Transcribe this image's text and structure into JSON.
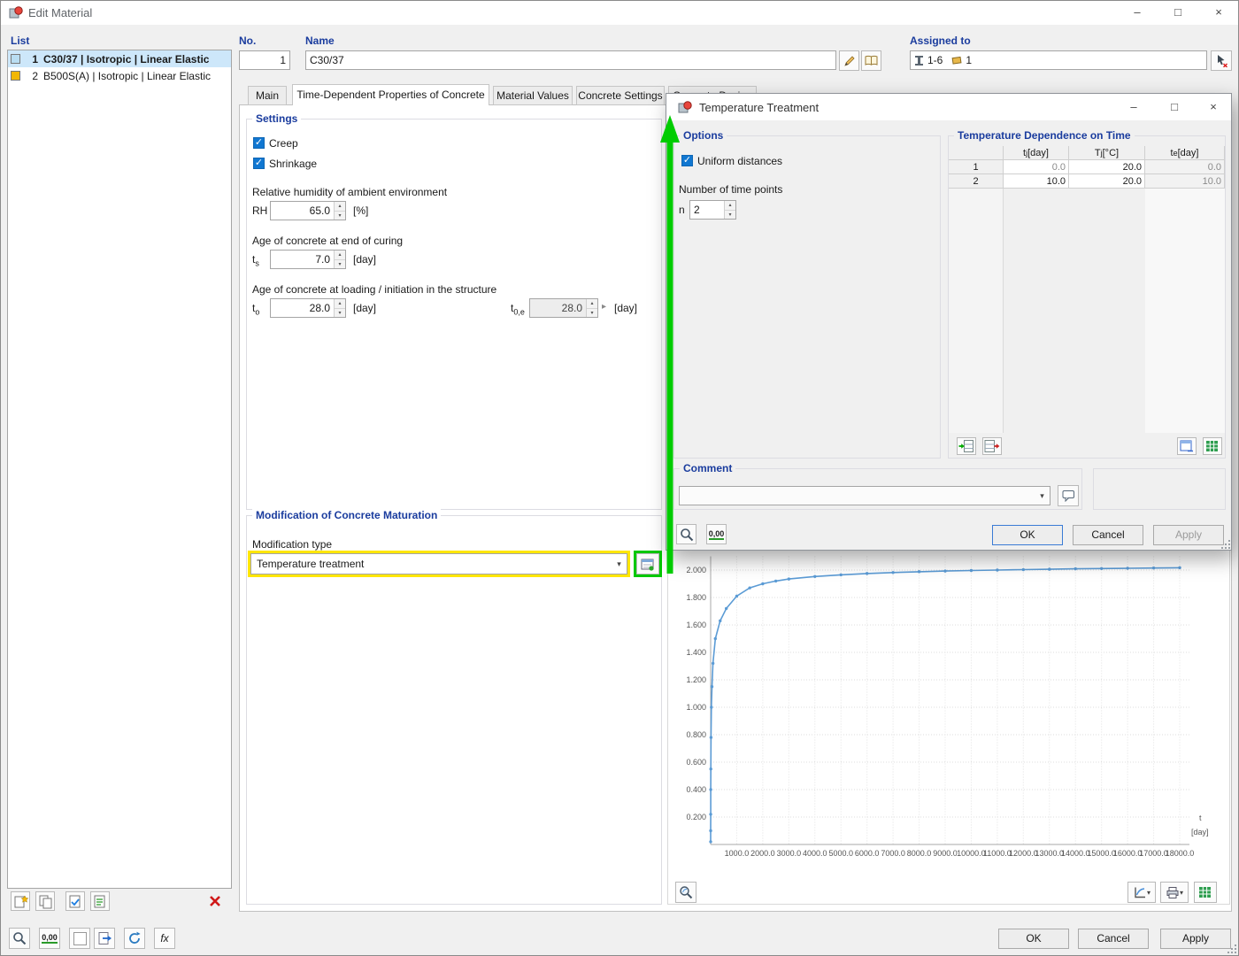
{
  "window": {
    "title": "Edit Material",
    "controls": {
      "minimize": "–",
      "maximize": "□",
      "close": "×"
    }
  },
  "icons": {
    "check": "✓",
    "dropdown": "▾",
    "spin_up": "▴",
    "spin_down": "▾",
    "expand": "▸",
    "decimal": "0,00",
    "formula": "fx"
  },
  "list_panel": {
    "header": "List",
    "items": [
      {
        "no": "1",
        "label": "C30/37 | Isotropic | Linear Elastic",
        "swatch": "#b9ddf2"
      },
      {
        "no": "2",
        "label": "B500S(A) | Isotropic | Linear Elastic",
        "swatch": "#f2b705"
      }
    ]
  },
  "header_fields": {
    "no_label": "No.",
    "no_value": "1",
    "name_label": "Name",
    "name_value": "C30/37",
    "assigned_label": "Assigned to",
    "assigned_members": "1-6",
    "assigned_objects": "1"
  },
  "tabs": [
    {
      "label": "Main"
    },
    {
      "label": "Time-Dependent Properties of Concrete"
    },
    {
      "label": "Material Values"
    },
    {
      "label": "Concrete Settings"
    },
    {
      "label": "Concrete Design"
    }
  ],
  "settings": {
    "header": "Settings",
    "creep_label": "Creep",
    "shrinkage_label": "Shrinkage",
    "rh_caption": "Relative humidity of ambient environment",
    "rh_label": "RH",
    "rh_value": "65.0",
    "rh_unit": "[%]",
    "ts_caption": "Age of concrete at end of curing",
    "ts_sym": "t",
    "ts_sub": "s",
    "ts_value": "7.0",
    "ts_unit": "[day]",
    "t0_caption": "Age of concrete at loading / initiation in the structure",
    "t0_sym": "t",
    "t0_sub": "o",
    "t0_value": "28.0",
    "t0_unit": "[day]",
    "t0e_sym": "t",
    "t0e_sub": "0,e",
    "t0e_value": "28.0",
    "t0e_unit": "[day]"
  },
  "modification": {
    "header": "Modification of Concrete Maturation",
    "type_label": "Modification type",
    "type_value": "Temperature treatment"
  },
  "temp_dialog": {
    "title": "Temperature Treatment",
    "controls": {
      "minimize": "–",
      "maximize": "□",
      "close": "×"
    },
    "options": {
      "header": "Options",
      "uniform_label": "Uniform distances",
      "points_caption": "Number of time points",
      "n_label": "n",
      "n_value": "2"
    },
    "table": {
      "header": "Temperature Dependence on Time",
      "columns": [
        {
          "sym": "t",
          "sub": "j",
          "unit": " [day]"
        },
        {
          "sym": "T",
          "sub": "j",
          "unit": " [°C]"
        },
        {
          "sym": "t",
          "sub": "e",
          "unit": " [day]"
        }
      ],
      "rows": [
        {
          "no": "1",
          "tj": "0.0",
          "Tj": "20.0",
          "te": "0.0"
        },
        {
          "no": "2",
          "tj": "10.0",
          "Tj": "20.0",
          "te": "10.0"
        }
      ]
    },
    "comment_header": "Comment",
    "comment_value": "",
    "buttons": {
      "ok": "OK",
      "cancel": "Cancel",
      "apply": "Apply"
    }
  },
  "chart_data": {
    "type": "line",
    "title": "",
    "xlabel": "t",
    "x_unit": "[day]",
    "ylabel": "",
    "xlim": [
      0,
      18400
    ],
    "ylim": [
      0,
      2.1
    ],
    "grid": true,
    "legend": false,
    "line_color": "#5b9bd5",
    "x_ticks": [
      1000,
      2000,
      3000,
      4000,
      5000,
      6000,
      7000,
      8000,
      9000,
      10000,
      11000,
      12000,
      13000,
      14000,
      15000,
      16000,
      17000,
      18000
    ],
    "x_tick_labels": [
      "1000.0",
      "2000.0",
      "3000.0",
      "4000.0",
      "5000.0",
      "6000.0",
      "7000.0",
      "8000.0",
      "9000.0",
      "10000.0",
      "11000.0",
      "12000.0",
      "13000.0",
      "14000.0",
      "15000.0",
      "16000.0",
      "17000.0",
      "18000.0"
    ],
    "y_ticks": [
      0.2,
      0.4,
      0.6,
      0.8,
      1.0,
      1.2,
      1.4,
      1.6,
      1.8,
      2.0
    ],
    "y_tick_labels": [
      "0.200",
      "0.400",
      "0.600",
      "0.800",
      "1.000",
      "1.200",
      "1.400",
      "1.600",
      "1.800",
      "2.000"
    ],
    "points": [
      [
        0.3,
        0.02
      ],
      [
        1,
        0.1
      ],
      [
        2,
        0.22
      ],
      [
        4,
        0.4
      ],
      [
        7,
        0.55
      ],
      [
        14,
        0.78
      ],
      [
        28,
        1.0
      ],
      [
        50,
        1.15
      ],
      [
        90,
        1.32
      ],
      [
        180,
        1.5
      ],
      [
        365,
        1.63
      ],
      [
        600,
        1.72
      ],
      [
        1000,
        1.81
      ],
      [
        1500,
        1.87
      ],
      [
        2000,
        1.9
      ],
      [
        2500,
        1.92
      ],
      [
        3000,
        1.935
      ],
      [
        4000,
        1.953
      ],
      [
        5000,
        1.965
      ],
      [
        6000,
        1.975
      ],
      [
        7000,
        1.982
      ],
      [
        8000,
        1.988
      ],
      [
        9000,
        1.993
      ],
      [
        10000,
        1.997
      ],
      [
        11000,
        2.0
      ],
      [
        12000,
        2.003
      ],
      [
        13000,
        2.006
      ],
      [
        14000,
        2.009
      ],
      [
        15000,
        2.011
      ],
      [
        16000,
        2.013
      ],
      [
        17000,
        2.015
      ],
      [
        18000,
        2.017
      ]
    ]
  },
  "footer": {
    "ok": "OK",
    "cancel": "Cancel",
    "apply": "Apply"
  }
}
